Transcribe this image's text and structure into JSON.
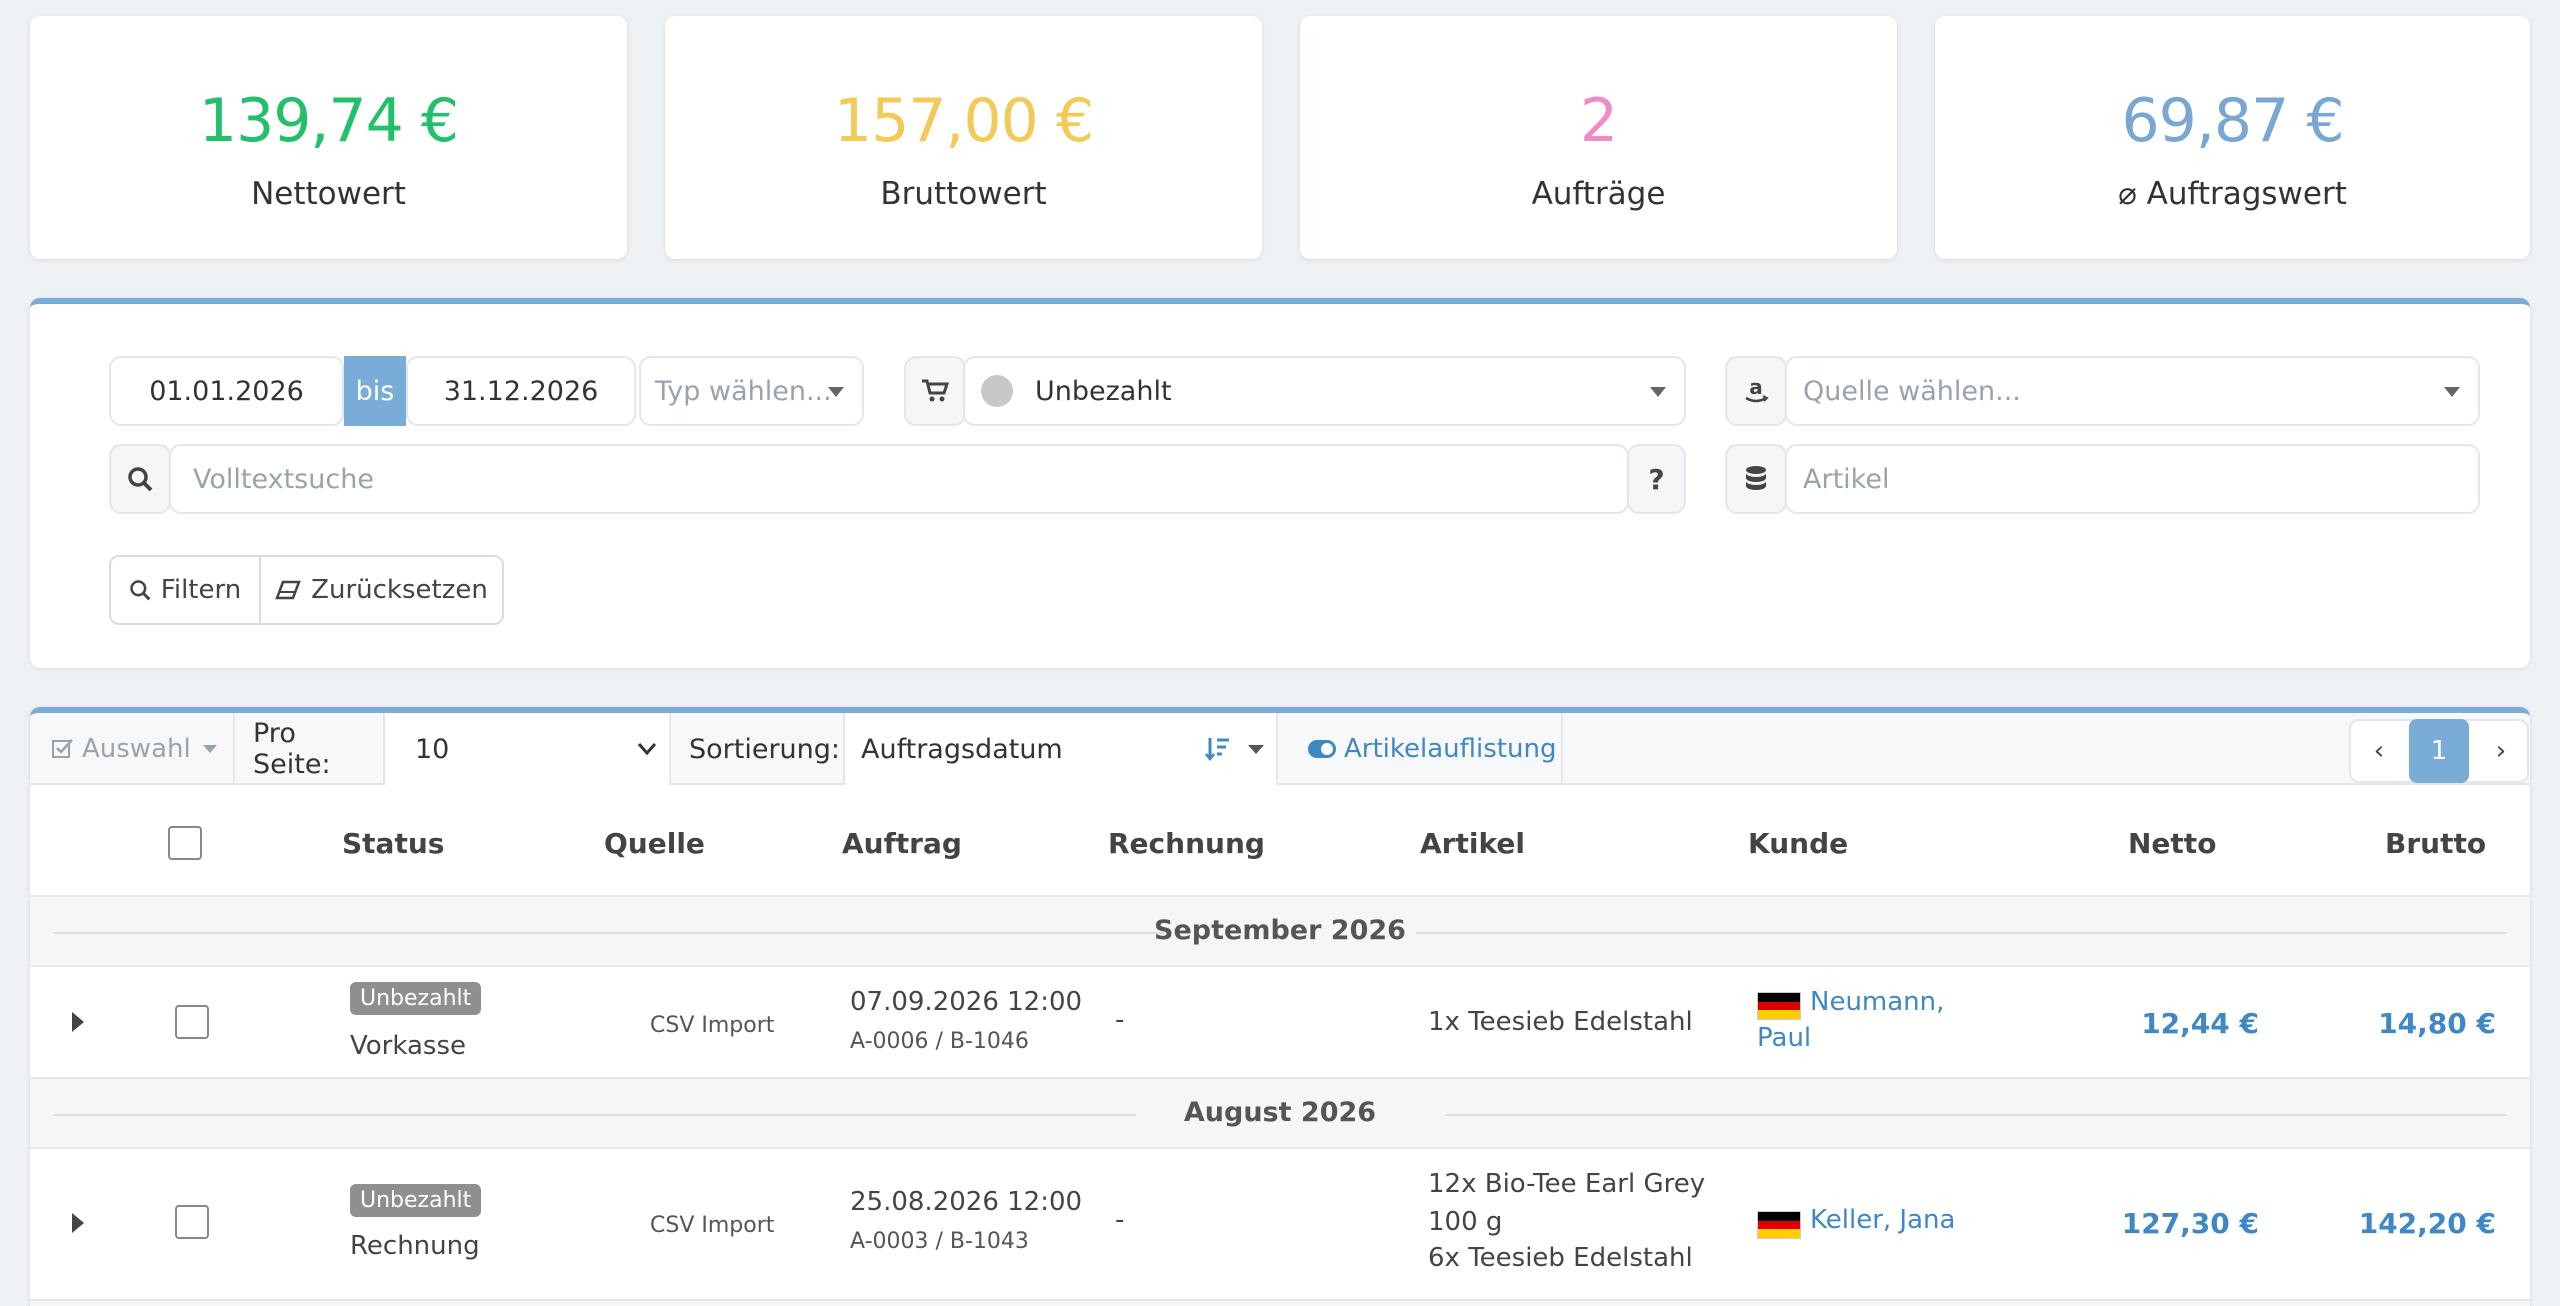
{
  "stats": [
    {
      "value": "139,74 €",
      "label": "Nettowert",
      "color": "#22c06a"
    },
    {
      "value": "157,00 €",
      "label": "Bruttowert",
      "color": "#f3c957"
    },
    {
      "value": "2",
      "label": "Aufträge",
      "color": "#f28ac7"
    },
    {
      "value": "69,87 €",
      "label": "⌀ Auftragswert",
      "color": "#79a6d2"
    }
  ],
  "filters": {
    "date_from": "01.01.2026",
    "date_sep": "bis",
    "date_to": "31.12.2026",
    "type_placeholder": "Typ wählen...",
    "payment_status": "Unbezahlt",
    "source_placeholder": "Quelle wählen...",
    "search_placeholder": "Volltextsuche",
    "help": "?",
    "article_placeholder": "Artikel",
    "filter_button": "Filtern",
    "reset_button": "Zurücksetzen"
  },
  "toolbar": {
    "selection": "Auswahl",
    "per_page_label": "Pro Seite:",
    "per_page_value": "10",
    "sort_label": "Sortierung:",
    "sort_value": "Auftragsdatum",
    "article_listing": "Artikelauflistung",
    "current_page": "1"
  },
  "table": {
    "headers": {
      "status": "Status",
      "source": "Quelle",
      "order": "Auftrag",
      "invoice": "Rechnung",
      "article": "Artikel",
      "customer": "Kunde",
      "net": "Netto",
      "gross": "Brutto"
    },
    "groups": [
      {
        "label": "September 2026",
        "rows": [
          {
            "badge": "Unbezahlt",
            "payment": "Vorkasse",
            "source": "CSV Import",
            "order_date": "07.09.2026 12:00",
            "order_ids": "A-0006 / B-1046",
            "invoice": "-",
            "articles": [
              "1x Teesieb Edelstahl"
            ],
            "customer": [
              "Neumann,",
              "Paul"
            ],
            "net": "12,44 €",
            "gross": "14,80 €"
          }
        ]
      },
      {
        "label": "August 2026",
        "rows": [
          {
            "badge": "Unbezahlt",
            "payment": "Rechnung",
            "source": "CSV Import",
            "order_date": "25.08.2026 12:00",
            "order_ids": "A-0003 / B-1043",
            "invoice": "-",
            "articles": [
              "12x Bio-Tee Earl Grey",
              "100 g",
              "6x Teesieb Edelstahl"
            ],
            "customer": [
              "Keller, Jana"
            ],
            "net": "127,30 €",
            "gross": "142,20 €"
          }
        ]
      }
    ]
  }
}
